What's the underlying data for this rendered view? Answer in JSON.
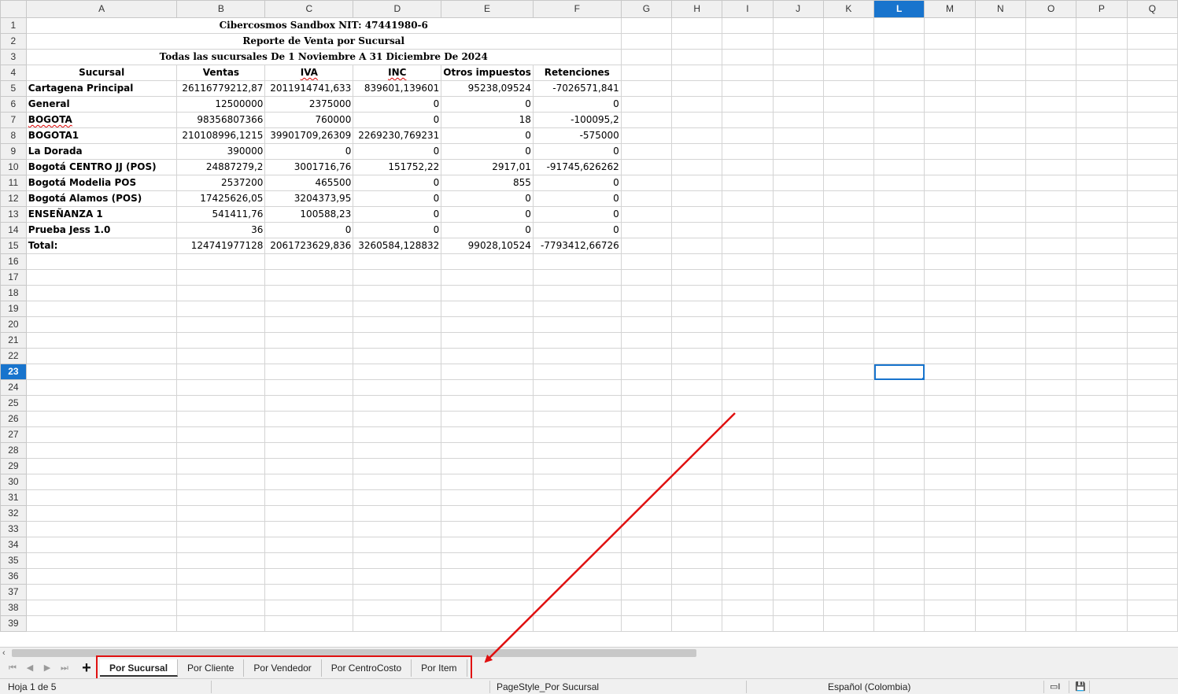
{
  "columns": [
    "A",
    "B",
    "C",
    "D",
    "E",
    "F",
    "G",
    "H",
    "I",
    "J",
    "K",
    "L",
    "M",
    "N",
    "O",
    "P",
    "Q"
  ],
  "selected_column": "L",
  "selected_row": 23,
  "rows_visible": 39,
  "title_lines": [
    "Cibercosmos Sandbox  NIT: 47441980-6",
    "Reporte de Venta por Sucursal",
    "Todas las sucursales De 1 Noviembre A 31 Diciembre De 2024"
  ],
  "headers": [
    "Sucursal",
    "Ventas",
    "IVA",
    "INC",
    "Otros impuestos",
    "Retenciones"
  ],
  "data_rows": [
    [
      "Cartagena Principal",
      "26116779212,87",
      "2011914741,633",
      "839601,139601",
      "95238,09524",
      "-7026571,841"
    ],
    [
      "General",
      "12500000",
      "2375000",
      "0",
      "0",
      "0"
    ],
    [
      "BOGOTA",
      "98356807366",
      "760000",
      "0",
      "18",
      "-100095,2"
    ],
    [
      "BOGOTA1",
      "210108996,1215",
      "39901709,26309",
      "2269230,769231",
      "0",
      "-575000"
    ],
    [
      "La Dorada",
      "390000",
      "0",
      "0",
      "0",
      "0"
    ],
    [
      "Bogotá CENTRO JJ (POS)",
      "24887279,2",
      "3001716,76",
      "151752,22",
      "2917,01",
      "-91745,626262"
    ],
    [
      "Bogotá Modelia POS",
      "2537200",
      "465500",
      "0",
      "855",
      "0"
    ],
    [
      "Bogotá Alamos (POS)",
      "17425626,05",
      "3204373,95",
      "0",
      "0",
      "0"
    ],
    [
      "ENSEÑANZA 1",
      "541411,76",
      "100588,23",
      "0",
      "0",
      "0"
    ],
    [
      "Prueba Jess 1.0",
      "36",
      "0",
      "0",
      "0",
      "0"
    ],
    [
      "Total:",
      "124741977128",
      "2061723629,836",
      "3260584,128832",
      "99028,10524",
      "-7793412,66726"
    ]
  ],
  "sheet_tabs": [
    "Por Sucursal",
    "Por Cliente",
    "Por Vendedor",
    "Por CentroCosto",
    "Por Item"
  ],
  "active_tab": "Por Sucursal",
  "status": {
    "sheet_position": "Hoja 1 de 5",
    "page_style": "PageStyle_Por Sucursal",
    "language": "Español (Colombia)"
  },
  "colors": {
    "selection": "#1874cd",
    "annotation": "#e01010"
  },
  "icons": {
    "first_sheet": "first-sheet-icon",
    "prev_sheet": "prev-sheet-icon",
    "next_sheet": "next-sheet-icon",
    "last_sheet": "last-sheet-icon",
    "add_sheet": "plus-icon",
    "scroll_left": "scroll-left-icon"
  }
}
